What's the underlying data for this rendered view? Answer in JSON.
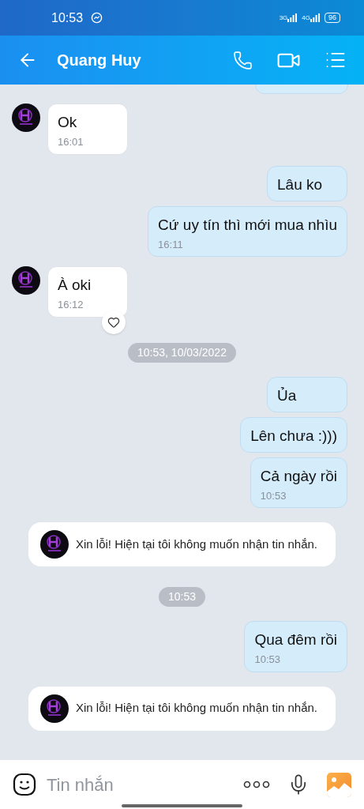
{
  "status_bar": {
    "time": "10:53",
    "network_1": "3G",
    "network_2": "4G",
    "battery": "96"
  },
  "header": {
    "title": "Quang Huy"
  },
  "messages": [
    {
      "kind": "outgoing_cut"
    },
    {
      "kind": "incoming",
      "text": "Ok",
      "time": "16:01",
      "reaction": false
    },
    {
      "kind": "outgoing",
      "text": "Lâu ko"
    },
    {
      "kind": "outgoing",
      "text": "Cứ uy tín thì mới mua nhìu",
      "time": "16:11"
    },
    {
      "kind": "incoming",
      "text": "À oki",
      "time": "16:12",
      "reaction": true
    },
    {
      "kind": "date",
      "text": "10:53, 10/03/2022"
    },
    {
      "kind": "outgoing",
      "text": "Ủa"
    },
    {
      "kind": "outgoing",
      "text": "Lên chưa :)))"
    },
    {
      "kind": "outgoing",
      "text": "Cả ngày rồi",
      "time": "10:53"
    },
    {
      "kind": "system",
      "text": "Xin lỗi! Hiện tại tôi không muốn nhận tin nhắn."
    },
    {
      "kind": "date",
      "text": "10:53"
    },
    {
      "kind": "outgoing",
      "text": "Qua đêm rồi",
      "time": "10:53"
    },
    {
      "kind": "system",
      "text": "Xin lỗi! Hiện tại tôi không muốn nhận tin nhắn."
    }
  ],
  "composer": {
    "placeholder": "Tin nhắn"
  }
}
